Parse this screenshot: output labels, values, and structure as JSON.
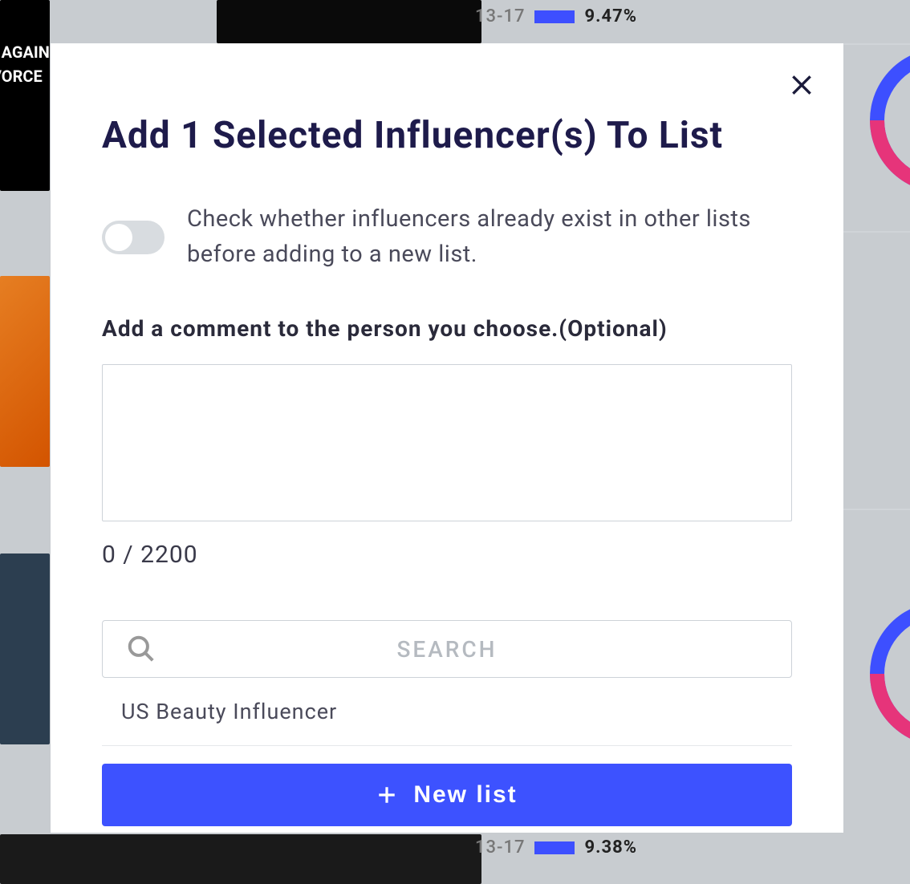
{
  "modal": {
    "title": "Add 1 Selected Influencer(s) To List",
    "toggle_label": "Check whether influencers already exist in other lists before adding to a new list.",
    "toggle_state": false,
    "comment_label": "Add a comment to the person you choose.(Optional)",
    "comment_value": "",
    "char_count": "0 / 2200",
    "search_placeholder": "SEARCH",
    "search_value": "",
    "lists": [
      {
        "name": "US Beauty Influencer"
      }
    ],
    "new_list_label": "New list"
  },
  "background": {
    "stats": [
      {
        "age": "13-17",
        "percent": "9.47%"
      },
      {
        "age": "13-17",
        "percent": "9.38%"
      }
    ]
  }
}
